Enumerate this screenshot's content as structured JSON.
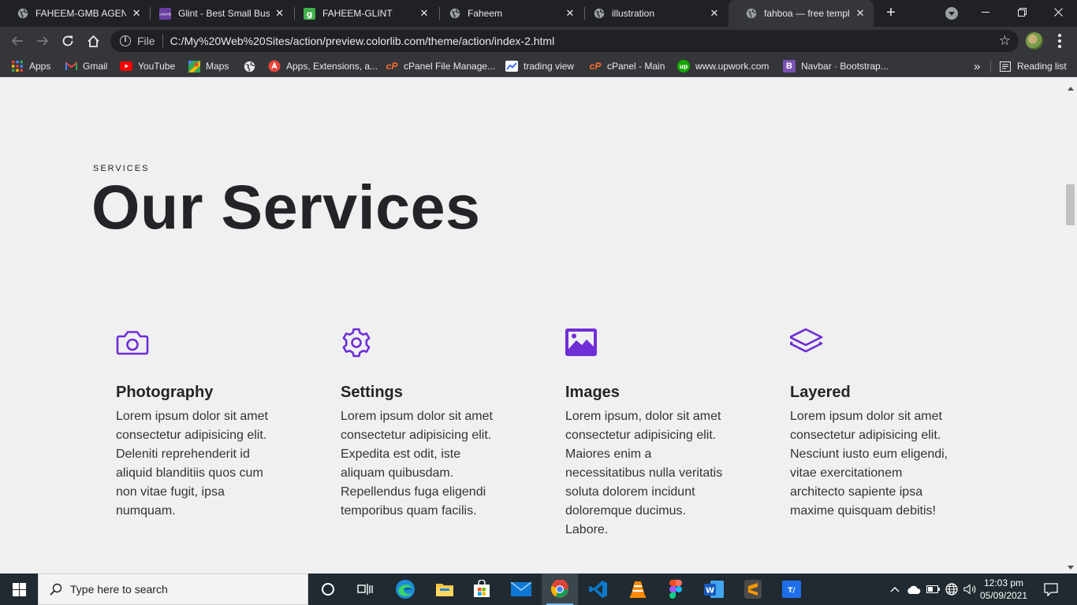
{
  "browser": {
    "tabs": [
      {
        "title": "FAHEEM-GMB AGENCY",
        "icon": "globe-icon",
        "active": false
      },
      {
        "title": "Glint - Best Small Business",
        "icon": "colorlib-icon",
        "active": false
      },
      {
        "title": "FAHEEM-GLINT",
        "icon": "glint-g-icon",
        "active": false
      },
      {
        "title": "Faheem",
        "icon": "globe-icon",
        "active": false
      },
      {
        "title": "illustration",
        "icon": "globe-icon",
        "active": false
      },
      {
        "title": "fahboa — free template",
        "icon": "globe-icon",
        "active": true
      }
    ],
    "omnibox": {
      "scheme_label": "File",
      "url": "C:/My%20Web%20Sites/action/preview.colorlib.com/theme/action/index-2.html"
    },
    "bookmarks": [
      {
        "label": "Apps",
        "icon": "apps-grid-icon",
        "color": "#ea4335"
      },
      {
        "label": "Gmail",
        "icon": "gmail-icon",
        "color": "#ea4335"
      },
      {
        "label": "YouTube",
        "icon": "youtube-icon",
        "color": "#ff0000"
      },
      {
        "label": "Maps",
        "icon": "maps-icon",
        "color": "#34a853"
      },
      {
        "label": "",
        "icon": "globe-icon",
        "color": "#e8eaed"
      },
      {
        "label": "Apps, Extensions, a...",
        "icon": "web-store-icon",
        "color": "#e8453c"
      },
      {
        "label": "cPanel File Manage...",
        "icon": "cpanel-icon",
        "color": "#ff6c2c"
      },
      {
        "label": "trading view",
        "icon": "trading-view-icon",
        "color": "#2962ff"
      },
      {
        "label": "cPanel - Main",
        "icon": "cpanel-icon",
        "color": "#ff6c2c"
      },
      {
        "label": "www.upwork.com",
        "icon": "upwork-icon",
        "color": "#14a800"
      },
      {
        "label": "Navbar · Bootstrap...",
        "icon": "bootstrap-icon",
        "color": "#7952b3"
      }
    ],
    "reading_list_label": "Reading list",
    "overflow_label": "»"
  },
  "page": {
    "eyebrow": "SERVICES",
    "heading": "Our Services",
    "accent_color": "#6f2dd6",
    "services": [
      {
        "icon": "camera-icon",
        "title": "Photography",
        "text": "Lorem ipsum dolor sit amet consectetur adipisicing elit. Deleniti reprehenderit id aliquid blanditiis quos cum non vitae fugit, ipsa numquam."
      },
      {
        "icon": "gear-icon",
        "title": "Settings",
        "text": "Lorem ipsum dolor sit amet consectetur adipisicing elit. Expedita est odit, iste aliquam quibusdam. Repellendus fuga eligendi temporibus quam facilis."
      },
      {
        "icon": "image-icon",
        "title": "Images",
        "text": "Lorem ipsum, dolor sit amet consectetur adipisicing elit. Maiores enim a necessitatibus nulla veritatis soluta dolorem incidunt doloremque ducimus. Labore."
      },
      {
        "icon": "layers-icon",
        "title": "Layered",
        "text": "Lorem ipsum dolor sit amet consectetur adipisicing elit. Nesciunt iusto eum eligendi, vitae exercitationem architecto sapiente ipsa maxime quisquam debitis!"
      }
    ]
  },
  "taskbar": {
    "search_placeholder": "Type here to search",
    "apps": [
      "cortana-icon",
      "task-view-icon",
      "edge-icon",
      "file-explorer-icon",
      "store-icon",
      "mail-icon",
      "chrome-icon",
      "vscode-icon",
      "vlc-icon",
      "figma-icon",
      "word-icon",
      "sublime-icon",
      "typora-icon"
    ],
    "active_app": "chrome-icon",
    "time": "12:03 pm",
    "date": "05/09/2021"
  }
}
